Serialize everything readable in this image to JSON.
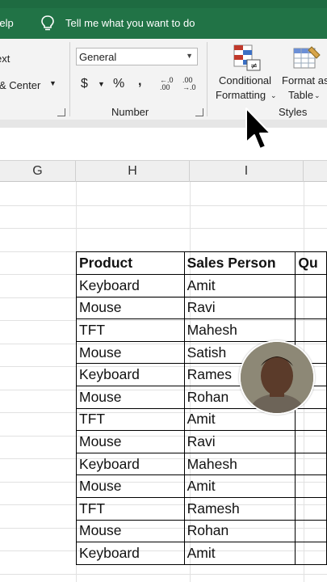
{
  "titlebar": {
    "help_label": "Help",
    "tell_me": "Tell me what you want to do"
  },
  "ribbon": {
    "wrap_text_fragment": "ext",
    "merge_center_fragment": "& Center",
    "number_format_value": "General",
    "currency_symbol": "$",
    "percent_symbol": "%",
    "comma_symbol": ",",
    "increase_decimal": "←.0 .00",
    "decrease_decimal": ".00 →.0",
    "number_group_label": "Number",
    "conditional_formatting_line1": "Conditional",
    "conditional_formatting_line2": "Formatting",
    "format_as_table_line1": "Format as",
    "format_as_table_line2": "Table",
    "styles_group_label": "Styles"
  },
  "columns": [
    "G",
    "H",
    "I"
  ],
  "table": {
    "headers": [
      "Product",
      "Sales Person",
      "Qu"
    ],
    "rows": [
      [
        "Keyboard",
        "Amit"
      ],
      [
        "Mouse",
        "Ravi"
      ],
      [
        "TFT",
        "Mahesh"
      ],
      [
        "Mouse",
        "Satish"
      ],
      [
        "Keyboard",
        "Rames"
      ],
      [
        "Mouse",
        "Rohan"
      ],
      [
        "TFT",
        "Amit"
      ],
      [
        "Mouse",
        "Ravi"
      ],
      [
        "Keyboard",
        "Mahesh"
      ],
      [
        "Mouse",
        "Amit"
      ],
      [
        "TFT",
        "Ramesh"
      ],
      [
        "Mouse",
        "Rohan"
      ],
      [
        "Keyboard",
        "Amit"
      ]
    ]
  },
  "colors": {
    "excel_green": "#217346",
    "ribbon_bg": "#f3f3f3"
  }
}
